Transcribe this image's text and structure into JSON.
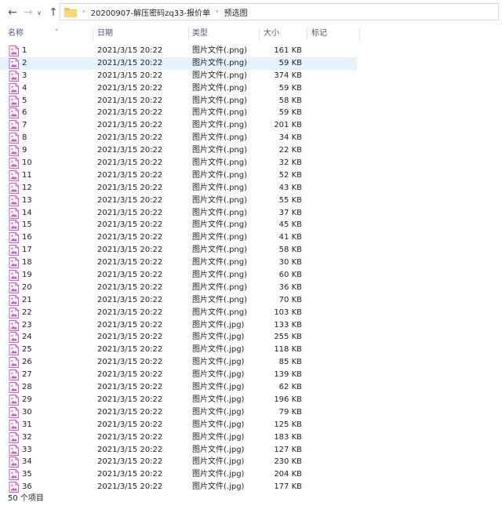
{
  "address": {
    "crumbs": [
      "20200907-解压密码zq33-报价单",
      "预选图"
    ]
  },
  "columns": {
    "name": "名称",
    "date": "日期",
    "type": "类型",
    "size": "大小",
    "tags": "标记"
  },
  "rows": [
    {
      "name": "1",
      "date": "2021/3/15 20:22",
      "type": "图片文件(.png)",
      "size": "161 KB"
    },
    {
      "name": "2",
      "date": "2021/3/15 20:22",
      "type": "图片文件(.png)",
      "size": "59 KB"
    },
    {
      "name": "3",
      "date": "2021/3/15 20:22",
      "type": "图片文件(.png)",
      "size": "374 KB"
    },
    {
      "name": "4",
      "date": "2021/3/15 20:22",
      "type": "图片文件(.png)",
      "size": "59 KB"
    },
    {
      "name": "5",
      "date": "2021/3/15 20:22",
      "type": "图片文件(.png)",
      "size": "58 KB"
    },
    {
      "name": "6",
      "date": "2021/3/15 20:22",
      "type": "图片文件(.png)",
      "size": "59 KB"
    },
    {
      "name": "7",
      "date": "2021/3/15 20:22",
      "type": "图片文件(.png)",
      "size": "201 KB"
    },
    {
      "name": "8",
      "date": "2021/3/15 20:22",
      "type": "图片文件(.png)",
      "size": "34 KB"
    },
    {
      "name": "9",
      "date": "2021/3/15 20:22",
      "type": "图片文件(.png)",
      "size": "22 KB"
    },
    {
      "name": "10",
      "date": "2021/3/15 20:22",
      "type": "图片文件(.png)",
      "size": "32 KB"
    },
    {
      "name": "11",
      "date": "2021/3/15 20:22",
      "type": "图片文件(.png)",
      "size": "52 KB"
    },
    {
      "name": "12",
      "date": "2021/3/15 20:22",
      "type": "图片文件(.png)",
      "size": "43 KB"
    },
    {
      "name": "13",
      "date": "2021/3/15 20:22",
      "type": "图片文件(.png)",
      "size": "55 KB"
    },
    {
      "name": "14",
      "date": "2021/3/15 20:22",
      "type": "图片文件(.png)",
      "size": "37 KB"
    },
    {
      "name": "15",
      "date": "2021/3/15 20:22",
      "type": "图片文件(.png)",
      "size": "45 KB"
    },
    {
      "name": "16",
      "date": "2021/3/15 20:22",
      "type": "图片文件(.png)",
      "size": "41 KB"
    },
    {
      "name": "17",
      "date": "2021/3/15 20:22",
      "type": "图片文件(.png)",
      "size": "58 KB"
    },
    {
      "name": "18",
      "date": "2021/3/15 20:22",
      "type": "图片文件(.png)",
      "size": "30 KB"
    },
    {
      "name": "19",
      "date": "2021/3/15 20:22",
      "type": "图片文件(.png)",
      "size": "60 KB"
    },
    {
      "name": "20",
      "date": "2021/3/15 20:22",
      "type": "图片文件(.png)",
      "size": "36 KB"
    },
    {
      "name": "21",
      "date": "2021/3/15 20:22",
      "type": "图片文件(.png)",
      "size": "70 KB"
    },
    {
      "name": "22",
      "date": "2021/3/15 20:22",
      "type": "图片文件(.png)",
      "size": "103 KB"
    },
    {
      "name": "23",
      "date": "2021/3/15 20:22",
      "type": "图片文件(.jpg)",
      "size": "133 KB"
    },
    {
      "name": "24",
      "date": "2021/3/15 20:22",
      "type": "图片文件(.jpg)",
      "size": "255 KB"
    },
    {
      "name": "25",
      "date": "2021/3/15 20:22",
      "type": "图片文件(.jpg)",
      "size": "118 KB"
    },
    {
      "name": "26",
      "date": "2021/3/15 20:22",
      "type": "图片文件(.jpg)",
      "size": "85 KB"
    },
    {
      "name": "27",
      "date": "2021/3/15 20:22",
      "type": "图片文件(.jpg)",
      "size": "139 KB"
    },
    {
      "name": "28",
      "date": "2021/3/15 20:22",
      "type": "图片文件(.jpg)",
      "size": "62 KB"
    },
    {
      "name": "29",
      "date": "2021/3/15 20:22",
      "type": "图片文件(.jpg)",
      "size": "196 KB"
    },
    {
      "name": "30",
      "date": "2021/3/15 20:22",
      "type": "图片文件(.jpg)",
      "size": "79 KB"
    },
    {
      "name": "31",
      "date": "2021/3/15 20:22",
      "type": "图片文件(.jpg)",
      "size": "125 KB"
    },
    {
      "name": "32",
      "date": "2021/3/15 20:22",
      "type": "图片文件(.jpg)",
      "size": "183 KB"
    },
    {
      "name": "33",
      "date": "2021/3/15 20:22",
      "type": "图片文件(.jpg)",
      "size": "127 KB"
    },
    {
      "name": "34",
      "date": "2021/3/15 20:22",
      "type": "图片文件(.jpg)",
      "size": "230 KB"
    },
    {
      "name": "35",
      "date": "2021/3/15 20:22",
      "type": "图片文件(.jpg)",
      "size": "204 KB"
    },
    {
      "name": "36",
      "date": "2021/3/15 20:22",
      "type": "图片文件(.jpg)",
      "size": "177 KB"
    }
  ],
  "selected_index": 1,
  "status": {
    "item_count": "50 个项目"
  },
  "icons": {
    "back": "arrow-left-icon",
    "forward": "arrow-right-icon",
    "recent": "chevron-down-icon",
    "up": "arrow-up-icon",
    "folder": "folder-icon",
    "image_file": "image-file-icon"
  },
  "colors": {
    "selected_row": "#e5f3ff",
    "folder": "#f4c542",
    "image_icon": "#c35ec2"
  }
}
